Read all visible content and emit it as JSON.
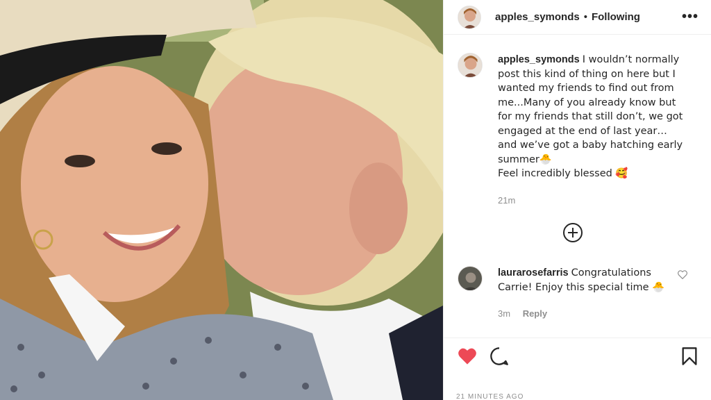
{
  "header": {
    "username": "apples_symonds",
    "separator": "•",
    "follow_status": "Following",
    "more_label": "•••"
  },
  "caption": {
    "username": "apples_symonds",
    "text": "I wouldn’t normally post this kind of thing on here but I wanted my friends to find out from me...Many of you already know but for my friends that still don’t, we got engaged at the end of last year… and we’ve got a baby hatching early summer🐣\nFeel incredibly blessed 🥰",
    "time": "21m"
  },
  "comment": {
    "username": "laurarosefarris",
    "text": "Congratulations Carrie! Enjoy this special time 🐣",
    "time": "3m",
    "reply_label": "Reply"
  },
  "timestamp": "21 MINUTES AGO",
  "icons": {
    "like": "heart-filled-icon",
    "comment": "speech-bubble-icon",
    "save": "bookmark-icon",
    "load_more": "plus-circle-icon",
    "comment_like": "heart-outline-icon"
  },
  "colors": {
    "like_red": "#ed4956",
    "text": "#262626",
    "muted": "#8e8e8e"
  }
}
